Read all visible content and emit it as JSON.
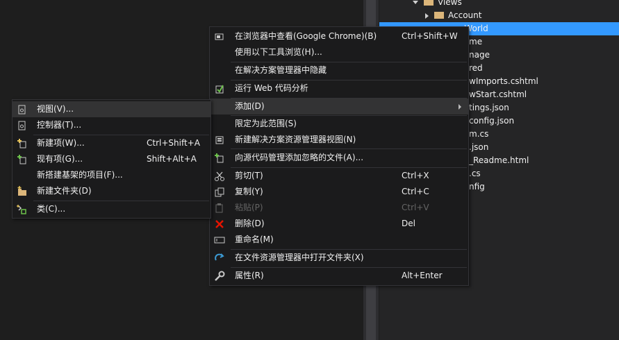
{
  "explorer": {
    "rows": [
      {
        "label": "Views"
      },
      {
        "label": "Account"
      },
      {
        "label": "HelloWorld"
      },
      {
        "label": "Home"
      },
      {
        "label": "Manage"
      },
      {
        "label": "Shared"
      },
      {
        "label": "_ViewImports.cshtml"
      },
      {
        "label": "_ViewStart.cshtml"
      },
      {
        "label": "appsettings.json"
      },
      {
        "label": "bundleconfig.json"
      },
      {
        "label": "Program.cs"
      },
      {
        "label": "project.json"
      },
      {
        "label": "Project_Readme.html"
      },
      {
        "label": "Startup.cs"
      },
      {
        "label": "web.config"
      }
    ],
    "visible_fragments": [
      "Views",
      "Account",
      "oWorld",
      "me",
      "nage",
      "red",
      "wImports.cshtml",
      "wStart.cshtml",
      "tings.json",
      "config.json",
      "m.cs",
      ".json",
      "_Readme.html",
      ".cs",
      "nfig"
    ]
  },
  "main_menu": {
    "items": [
      {
        "label": "在浏览器中查看(Google Chrome)(B)",
        "shortcut": "Ctrl+Shift+W"
      },
      {
        "label": "使用以下工具浏览(H)...",
        "shortcut": ""
      },
      {
        "label": "在解决方案管理器中隐藏",
        "shortcut": ""
      },
      {
        "label": "运行 Web 代码分析",
        "shortcut": ""
      },
      {
        "label": "添加(D)",
        "shortcut": ""
      },
      {
        "label": "限定为此范围(S)",
        "shortcut": ""
      },
      {
        "label": "新建解决方案资源管理器视图(N)",
        "shortcut": ""
      },
      {
        "label": "向源代码管理添加忽略的文件(A)...",
        "shortcut": ""
      },
      {
        "label": "剪切(T)",
        "shortcut": "Ctrl+X"
      },
      {
        "label": "复制(Y)",
        "shortcut": "Ctrl+C"
      },
      {
        "label": "粘贴(P)",
        "shortcut": "Ctrl+V"
      },
      {
        "label": "删除(D)",
        "shortcut": "Del"
      },
      {
        "label": "重命名(M)",
        "shortcut": ""
      },
      {
        "label": "在文件资源管理器中打开文件夹(X)",
        "shortcut": ""
      },
      {
        "label": "属性(R)",
        "shortcut": "Alt+Enter"
      }
    ]
  },
  "sub_menu": {
    "items": [
      {
        "label": "视图(V)...",
        "shortcut": ""
      },
      {
        "label": "控制器(T)...",
        "shortcut": ""
      },
      {
        "label": "新建项(W)...",
        "shortcut": "Ctrl+Shift+A"
      },
      {
        "label": "现有项(G)...",
        "shortcut": "Shift+Alt+A"
      },
      {
        "label": "新搭建基架的项目(F)...",
        "shortcut": ""
      },
      {
        "label": "新建文件夹(D)",
        "shortcut": ""
      },
      {
        "label": "类(C)...",
        "shortcut": ""
      }
    ]
  },
  "colors": {
    "background": "#1e1e1e",
    "menu_background": "#1b1b1c",
    "selection": "#3399ff",
    "hover": "#333334",
    "delete_red": "#e51400",
    "accent_green": "#6cc24a",
    "refresh_blue": "#3c9ad3"
  }
}
